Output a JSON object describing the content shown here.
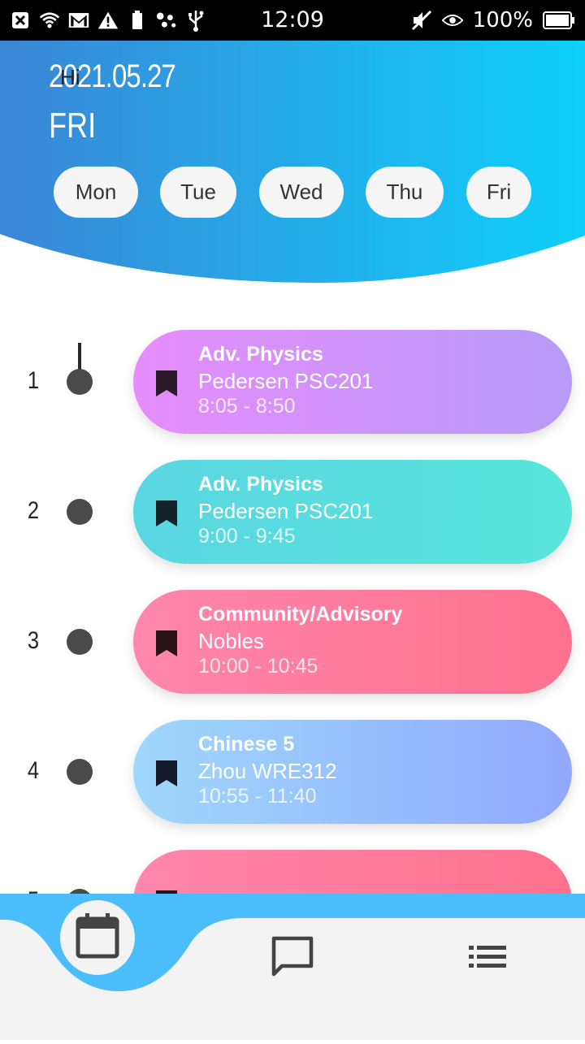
{
  "status_bar": {
    "time": "12:09",
    "battery_percent": "100%",
    "left_icons": [
      "close-box-icon",
      "wifi-icon",
      "gmail-icon",
      "warning-icon",
      "battery-small-icon",
      "dots-icon",
      "usb-icon"
    ],
    "right_icons": [
      "mute-icon",
      "eye-icon",
      "battery-icon"
    ]
  },
  "header": {
    "date": "2021.05.27",
    "greeting": "Hi",
    "day": "FRI",
    "gradient_start": "#3a86d6",
    "gradient_end": "#0fd0fb",
    "days": [
      "Mon",
      "Tue",
      "Wed",
      "Thu",
      "Fri"
    ]
  },
  "schedule": [
    {
      "period": "1",
      "title": "Adv. Physics",
      "subtitle": "Pedersen PSC201",
      "time": "8:05 - 8:50",
      "color_start": "#e68cfb",
      "color_end": "#b79bf7"
    },
    {
      "period": "2",
      "title": "Adv. Physics",
      "subtitle": "Pedersen PSC201",
      "time": "9:00 - 9:45",
      "color_start": "#5ad6e0",
      "color_end": "#58e6dc"
    },
    {
      "period": "3",
      "title": "Community/Advisory",
      "subtitle": "Nobles",
      "time": "10:00 - 10:45",
      "color_start": "#ff86ad",
      "color_end": "#ff718d"
    },
    {
      "period": "4",
      "title": "Chinese 5",
      "subtitle": "Zhou WRE312",
      "time": "10:55 - 11:40",
      "color_start": "#9fd8fd",
      "color_end": "#92a8fb"
    },
    {
      "period": "5",
      "title": "",
      "subtitle": "",
      "time": "",
      "color_start": "#ff86ad",
      "color_end": "#ff718d"
    }
  ],
  "bottom_nav": {
    "accent": "#4bbdfb",
    "items": [
      "calendar-icon",
      "chat-icon",
      "list-icon"
    ]
  }
}
